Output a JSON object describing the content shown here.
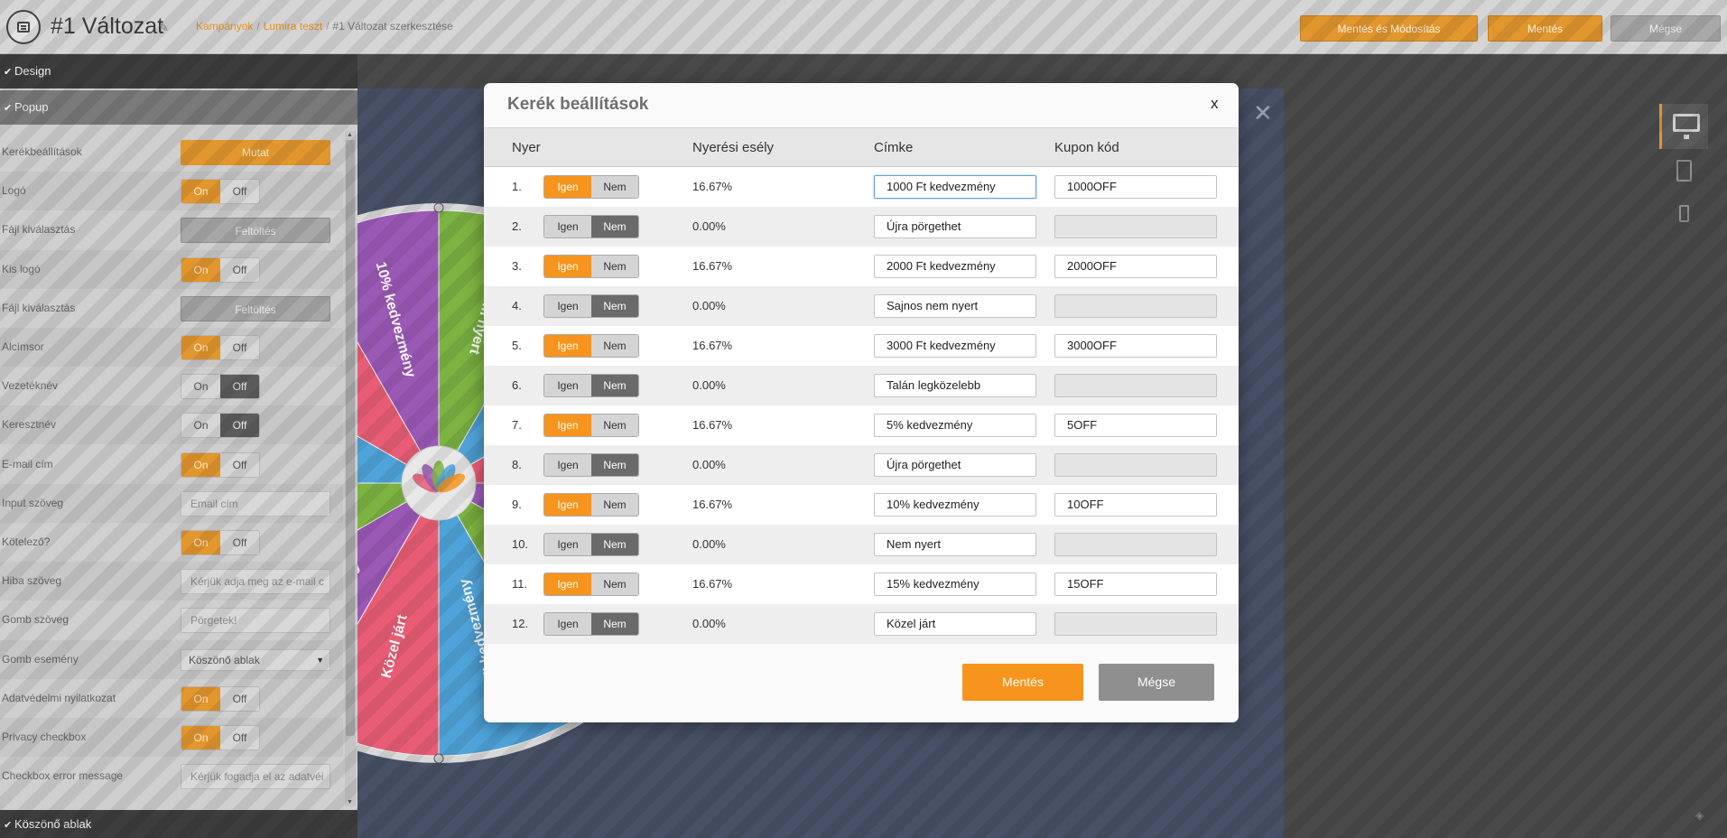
{
  "header": {
    "title": "#1 Változat",
    "breadcrumb": [
      "Kampányok",
      "Lumira teszt",
      "#1 Változat szerkesztése"
    ],
    "buttons": {
      "save_and_edit": "Mentés és Módosítás",
      "save": "Mentés",
      "cancel": "Mégse"
    }
  },
  "left_panel": {
    "sections": {
      "design": "Design",
      "popup": "Popup",
      "thanks": "Köszönő ablak"
    },
    "rows": [
      {
        "label": "Kerékbeállítások",
        "type": "button",
        "value": "Mutat"
      },
      {
        "label": "Logó",
        "type": "toggle",
        "on": true
      },
      {
        "label": "Fájl kiválasztás",
        "type": "upload",
        "value": "Feltöltés"
      },
      {
        "label": "Kis logó",
        "type": "toggle",
        "on": true
      },
      {
        "label": "Fájl kiválasztás",
        "type": "upload",
        "value": "Feltöltés"
      },
      {
        "label": "Alcímsor",
        "type": "toggle",
        "on": true
      },
      {
        "label": "Vezetéknév",
        "type": "toggle",
        "on": false
      },
      {
        "label": "Keresztnév",
        "type": "toggle",
        "on": false
      },
      {
        "label": "E-mail cím",
        "type": "toggle",
        "on": true
      },
      {
        "label": "Input szöveg",
        "type": "text",
        "value": "Email cím"
      },
      {
        "label": "Kötelező?",
        "type": "toggle",
        "on": true
      },
      {
        "label": "Hiba szöveg",
        "type": "text",
        "value": "Kérjük adja meg az e-mail c"
      },
      {
        "label": "Gomb szöveg",
        "type": "text",
        "value": "Pörgetek!"
      },
      {
        "label": "Gomb esemény",
        "type": "select",
        "value": "Köszönő ablak"
      },
      {
        "label": "Adatvédelmi nyilatkozat",
        "type": "toggle",
        "on": true
      },
      {
        "label": "Privacy checkbox",
        "type": "toggle",
        "on": true
      },
      {
        "label": "Checkbox error message",
        "type": "text",
        "value": "Kérjük fogadja el az adatvéi"
      }
    ],
    "toggle_labels": {
      "on": "On",
      "off": "Off"
    }
  },
  "wheel": {
    "segments": [
      "10% kedvezmény",
      "Nem nyert",
      "Újra pörgethet",
      "Talán legközelebb",
      "3000 Ft kedvezmény",
      "Sajnos nem nyert",
      "2000 Ft kedvezmény",
      "Közel járt",
      "5% kedvezmény",
      "15% kedvezmény",
      "1000 Ft kedvezmény",
      "Újra pörgethet"
    ],
    "colors": [
      "#9b59b6",
      "#7cb342",
      "#4fa3d9",
      "#e85d75"
    ]
  },
  "modal": {
    "title": "Kerék beállítások",
    "close": "x",
    "columns": {
      "win": "Nyer",
      "chance": "Nyerési esély",
      "label": "Címke",
      "coupon": "Kupon kód"
    },
    "yes_label": "Igen",
    "no_label": "Nem",
    "rows": [
      {
        "n": "1.",
        "win": true,
        "chance": "16.67%",
        "label": "1000 Ft kedvezmény",
        "coupon": "1000OFF"
      },
      {
        "n": "2.",
        "win": false,
        "chance": "0.00%",
        "label": "Újra pörgethet",
        "coupon": ""
      },
      {
        "n": "3.",
        "win": true,
        "chance": "16.67%",
        "label": "2000 Ft kedvezmény",
        "coupon": "2000OFF"
      },
      {
        "n": "4.",
        "win": false,
        "chance": "0.00%",
        "label": "Sajnos nem nyert",
        "coupon": ""
      },
      {
        "n": "5.",
        "win": true,
        "chance": "16.67%",
        "label": "3000 Ft kedvezmény",
        "coupon": "3000OFF"
      },
      {
        "n": "6.",
        "win": false,
        "chance": "0.00%",
        "label": "Talán legközelebb",
        "coupon": ""
      },
      {
        "n": "7.",
        "win": true,
        "chance": "16.67%",
        "label": "5% kedvezmény",
        "coupon": "5OFF"
      },
      {
        "n": "8.",
        "win": false,
        "chance": "0.00%",
        "label": "Újra pörgethet",
        "coupon": ""
      },
      {
        "n": "9.",
        "win": true,
        "chance": "16.67%",
        "label": "10% kedvezmény",
        "coupon": "10OFF"
      },
      {
        "n": "10.",
        "win": false,
        "chance": "0.00%",
        "label": "Nem nyert",
        "coupon": ""
      },
      {
        "n": "11.",
        "win": true,
        "chance": "16.67%",
        "label": "15% kedvezmény",
        "coupon": "15OFF"
      },
      {
        "n": "12.",
        "win": false,
        "chance": "0.00%",
        "label": "Közel járt",
        "coupon": ""
      }
    ],
    "buttons": {
      "save": "Mentés",
      "cancel": "Mégse"
    }
  },
  "colors": {
    "accent": "#f7941d",
    "stage": "#485166"
  }
}
